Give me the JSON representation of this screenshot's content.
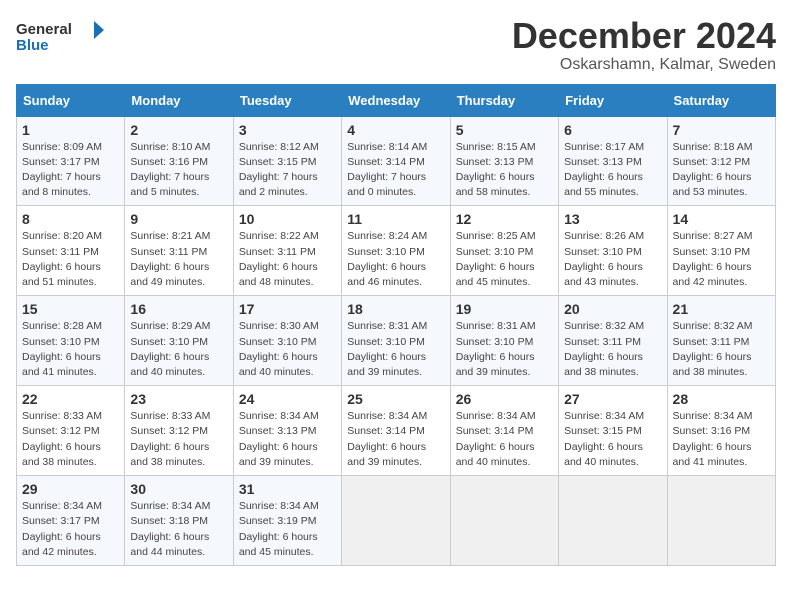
{
  "header": {
    "logo_line1": "General",
    "logo_line2": "Blue",
    "month": "December 2024",
    "location": "Oskarshamn, Kalmar, Sweden"
  },
  "days_of_week": [
    "Sunday",
    "Monday",
    "Tuesday",
    "Wednesday",
    "Thursday",
    "Friday",
    "Saturday"
  ],
  "weeks": [
    [
      {
        "day": 1,
        "sunrise": "Sunrise: 8:09 AM",
        "sunset": "Sunset: 3:17 PM",
        "daylight": "Daylight: 7 hours and 8 minutes."
      },
      {
        "day": 2,
        "sunrise": "Sunrise: 8:10 AM",
        "sunset": "Sunset: 3:16 PM",
        "daylight": "Daylight: 7 hours and 5 minutes."
      },
      {
        "day": 3,
        "sunrise": "Sunrise: 8:12 AM",
        "sunset": "Sunset: 3:15 PM",
        "daylight": "Daylight: 7 hours and 2 minutes."
      },
      {
        "day": 4,
        "sunrise": "Sunrise: 8:14 AM",
        "sunset": "Sunset: 3:14 PM",
        "daylight": "Daylight: 7 hours and 0 minutes."
      },
      {
        "day": 5,
        "sunrise": "Sunrise: 8:15 AM",
        "sunset": "Sunset: 3:13 PM",
        "daylight": "Daylight: 6 hours and 58 minutes."
      },
      {
        "day": 6,
        "sunrise": "Sunrise: 8:17 AM",
        "sunset": "Sunset: 3:13 PM",
        "daylight": "Daylight: 6 hours and 55 minutes."
      },
      {
        "day": 7,
        "sunrise": "Sunrise: 8:18 AM",
        "sunset": "Sunset: 3:12 PM",
        "daylight": "Daylight: 6 hours and 53 minutes."
      }
    ],
    [
      {
        "day": 8,
        "sunrise": "Sunrise: 8:20 AM",
        "sunset": "Sunset: 3:11 PM",
        "daylight": "Daylight: 6 hours and 51 minutes."
      },
      {
        "day": 9,
        "sunrise": "Sunrise: 8:21 AM",
        "sunset": "Sunset: 3:11 PM",
        "daylight": "Daylight: 6 hours and 49 minutes."
      },
      {
        "day": 10,
        "sunrise": "Sunrise: 8:22 AM",
        "sunset": "Sunset: 3:11 PM",
        "daylight": "Daylight: 6 hours and 48 minutes."
      },
      {
        "day": 11,
        "sunrise": "Sunrise: 8:24 AM",
        "sunset": "Sunset: 3:10 PM",
        "daylight": "Daylight: 6 hours and 46 minutes."
      },
      {
        "day": 12,
        "sunrise": "Sunrise: 8:25 AM",
        "sunset": "Sunset: 3:10 PM",
        "daylight": "Daylight: 6 hours and 45 minutes."
      },
      {
        "day": 13,
        "sunrise": "Sunrise: 8:26 AM",
        "sunset": "Sunset: 3:10 PM",
        "daylight": "Daylight: 6 hours and 43 minutes."
      },
      {
        "day": 14,
        "sunrise": "Sunrise: 8:27 AM",
        "sunset": "Sunset: 3:10 PM",
        "daylight": "Daylight: 6 hours and 42 minutes."
      }
    ],
    [
      {
        "day": 15,
        "sunrise": "Sunrise: 8:28 AM",
        "sunset": "Sunset: 3:10 PM",
        "daylight": "Daylight: 6 hours and 41 minutes."
      },
      {
        "day": 16,
        "sunrise": "Sunrise: 8:29 AM",
        "sunset": "Sunset: 3:10 PM",
        "daylight": "Daylight: 6 hours and 40 minutes."
      },
      {
        "day": 17,
        "sunrise": "Sunrise: 8:30 AM",
        "sunset": "Sunset: 3:10 PM",
        "daylight": "Daylight: 6 hours and 40 minutes."
      },
      {
        "day": 18,
        "sunrise": "Sunrise: 8:31 AM",
        "sunset": "Sunset: 3:10 PM",
        "daylight": "Daylight: 6 hours and 39 minutes."
      },
      {
        "day": 19,
        "sunrise": "Sunrise: 8:31 AM",
        "sunset": "Sunset: 3:10 PM",
        "daylight": "Daylight: 6 hours and 39 minutes."
      },
      {
        "day": 20,
        "sunrise": "Sunrise: 8:32 AM",
        "sunset": "Sunset: 3:11 PM",
        "daylight": "Daylight: 6 hours and 38 minutes."
      },
      {
        "day": 21,
        "sunrise": "Sunrise: 8:32 AM",
        "sunset": "Sunset: 3:11 PM",
        "daylight": "Daylight: 6 hours and 38 minutes."
      }
    ],
    [
      {
        "day": 22,
        "sunrise": "Sunrise: 8:33 AM",
        "sunset": "Sunset: 3:12 PM",
        "daylight": "Daylight: 6 hours and 38 minutes."
      },
      {
        "day": 23,
        "sunrise": "Sunrise: 8:33 AM",
        "sunset": "Sunset: 3:12 PM",
        "daylight": "Daylight: 6 hours and 38 minutes."
      },
      {
        "day": 24,
        "sunrise": "Sunrise: 8:34 AM",
        "sunset": "Sunset: 3:13 PM",
        "daylight": "Daylight: 6 hours and 39 minutes."
      },
      {
        "day": 25,
        "sunrise": "Sunrise: 8:34 AM",
        "sunset": "Sunset: 3:14 PM",
        "daylight": "Daylight: 6 hours and 39 minutes."
      },
      {
        "day": 26,
        "sunrise": "Sunrise: 8:34 AM",
        "sunset": "Sunset: 3:14 PM",
        "daylight": "Daylight: 6 hours and 40 minutes."
      },
      {
        "day": 27,
        "sunrise": "Sunrise: 8:34 AM",
        "sunset": "Sunset: 3:15 PM",
        "daylight": "Daylight: 6 hours and 40 minutes."
      },
      {
        "day": 28,
        "sunrise": "Sunrise: 8:34 AM",
        "sunset": "Sunset: 3:16 PM",
        "daylight": "Daylight: 6 hours and 41 minutes."
      }
    ],
    [
      {
        "day": 29,
        "sunrise": "Sunrise: 8:34 AM",
        "sunset": "Sunset: 3:17 PM",
        "daylight": "Daylight: 6 hours and 42 minutes."
      },
      {
        "day": 30,
        "sunrise": "Sunrise: 8:34 AM",
        "sunset": "Sunset: 3:18 PM",
        "daylight": "Daylight: 6 hours and 44 minutes."
      },
      {
        "day": 31,
        "sunrise": "Sunrise: 8:34 AM",
        "sunset": "Sunset: 3:19 PM",
        "daylight": "Daylight: 6 hours and 45 minutes."
      },
      null,
      null,
      null,
      null
    ]
  ]
}
